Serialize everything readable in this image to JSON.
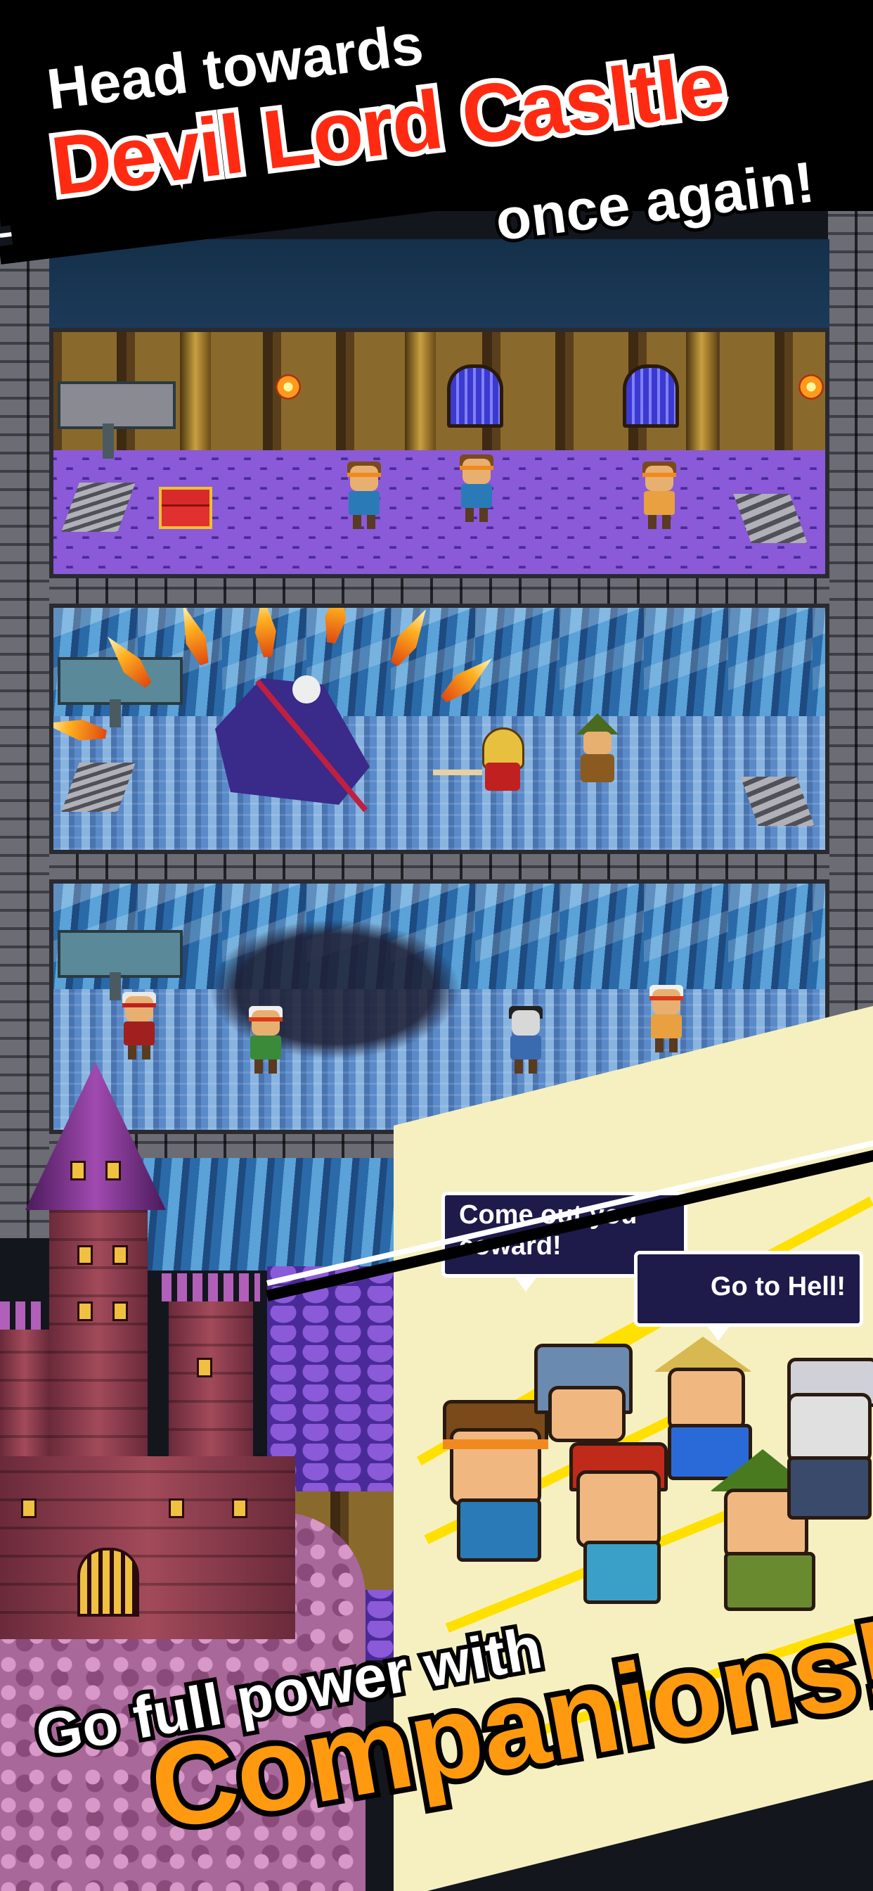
{
  "headline": {
    "line1": "Head towards",
    "line2": "Devil Lord Casltle",
    "line3": "once again!"
  },
  "speech": {
    "bubble1": "Come out you\ncoward!",
    "bubble2": "Go to Hell!"
  },
  "footer": {
    "line1": "Go full power with",
    "line2": "Companions!"
  },
  "colors": {
    "headline_red": "#ff2a12",
    "footer_orange": "#ff9a10",
    "text_white": "#ffffff",
    "outline_black": "#000000",
    "bubble_bg": "#1e1a4a"
  }
}
